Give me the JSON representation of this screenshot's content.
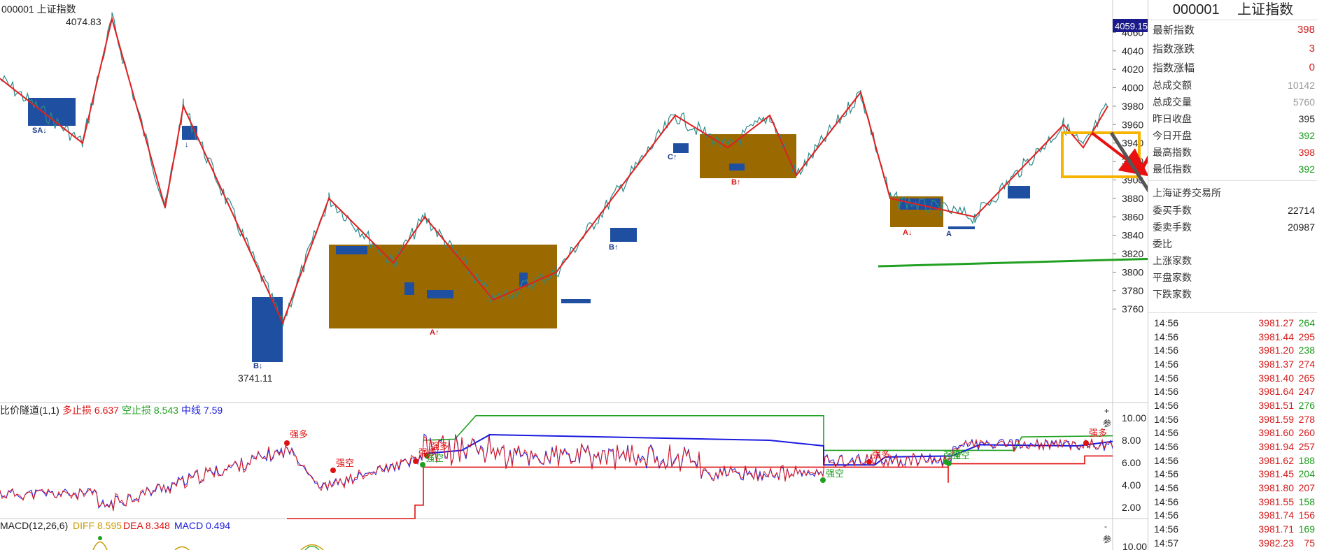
{
  "header": {
    "symbol_title": "000001 上证指数",
    "high_marker": "4074.83",
    "low_marker": "3741.11",
    "current_price_box": "4059.15"
  },
  "price_axis": {
    "ticks": [
      "4060",
      "4040",
      "4020",
      "4000",
      "3980",
      "3960",
      "3940",
      "3920",
      "3900",
      "3880",
      "3860",
      "3840",
      "3820",
      "3800",
      "3780",
      "3760"
    ]
  },
  "signal_labels": [
    {
      "text": "SA↓",
      "color": "#1b3a8a"
    },
    {
      "text": "↓",
      "color": "#1b3a8a"
    },
    {
      "text": "B↓",
      "color": "#1b3a8a"
    },
    {
      "text": "A↑",
      "color": "#d41a1a"
    },
    {
      "text": "B↑",
      "color": "#1b3a8a"
    },
    {
      "text": "C↑",
      "color": "#1b3a8a"
    },
    {
      "text": "B↑",
      "color": "#d41a1a"
    },
    {
      "text": "A↓",
      "color": "#d41a1a"
    },
    {
      "text": "A",
      "color": "#1b3a8a"
    }
  ],
  "indicator_panel": {
    "legend_name": "比价隧道(1,1)",
    "stop_long_label": "多止损 6.637",
    "stop_short_label": "空止损 8.543",
    "midline_label": "中线 7.59",
    "axis_ticks": [
      "10.00",
      "8.00",
      "6.00",
      "4.00",
      "2.00"
    ],
    "annotations": [
      "强多",
      "强空",
      "强多",
      "强多",
      "强空",
      "强空",
      "强空",
      "强多",
      "强空",
      "强多"
    ],
    "side_buttons": [
      "+",
      "参"
    ]
  },
  "macd_panel": {
    "legend_name": "MACD(12,26,6)",
    "diff_label": "DIFF 8.595",
    "dea_label": "DEA 8.348",
    "macd_label": "MACD 0.494",
    "axis_ticks": [
      "10.00"
    ],
    "side_buttons": [
      "-",
      "参"
    ]
  },
  "quote_panel": {
    "code": "000001",
    "name": "上证指数",
    "rows_main": [
      {
        "label": "最新指数",
        "value": "398",
        "style": "red"
      },
      {
        "label": "指数涨跌",
        "value": "3",
        "style": "red"
      },
      {
        "label": "指数涨幅",
        "value": "0",
        "style": "red"
      }
    ],
    "rows_detail": [
      {
        "label": "总成交额",
        "value": "10142",
        "style": "gray"
      },
      {
        "label": "总成交量",
        "value": "5760",
        "style": "gray"
      },
      {
        "label": "昨日收盘",
        "value": "395",
        "style": "black"
      },
      {
        "label": "今日开盘",
        "value": "392",
        "style": "green"
      },
      {
        "label": "最高指数",
        "value": "398",
        "style": "red"
      },
      {
        "label": "最低指数",
        "value": "392",
        "style": "green"
      }
    ],
    "exchange": "上海证券交易所",
    "rows_orders": [
      {
        "label": "委买手数",
        "value": "22714",
        "style": "black"
      },
      {
        "label": "委卖手数",
        "value": "20987",
        "style": "black"
      },
      {
        "label": "委比",
        "value": "",
        "style": "black"
      },
      {
        "label": "上涨家数",
        "value": "",
        "style": "red"
      },
      {
        "label": "平盘家数",
        "value": "",
        "style": "black"
      },
      {
        "label": "下跌家数",
        "value": "",
        "style": "green"
      }
    ],
    "ticks": [
      {
        "time": "14:56",
        "price": "3981.27",
        "vol": "264",
        "vc": "green"
      },
      {
        "time": "14:56",
        "price": "3981.44",
        "vol": "295",
        "vc": "red"
      },
      {
        "time": "14:56",
        "price": "3981.20",
        "vol": "238",
        "vc": "green"
      },
      {
        "time": "14:56",
        "price": "3981.37",
        "vol": "274",
        "vc": "red"
      },
      {
        "time": "14:56",
        "price": "3981.40",
        "vol": "265",
        "vc": "red"
      },
      {
        "time": "14:56",
        "price": "3981.64",
        "vol": "247",
        "vc": "red"
      },
      {
        "time": "14:56",
        "price": "3981.51",
        "vol": "276",
        "vc": "green"
      },
      {
        "time": "14:56",
        "price": "3981.59",
        "vol": "278",
        "vc": "red"
      },
      {
        "time": "14:56",
        "price": "3981.60",
        "vol": "260",
        "vc": "red"
      },
      {
        "time": "14:56",
        "price": "3981.94",
        "vol": "257",
        "vc": "red"
      },
      {
        "time": "14:56",
        "price": "3981.62",
        "vol": "188",
        "vc": "green"
      },
      {
        "time": "14:56",
        "price": "3981.45",
        "vol": "204",
        "vc": "green"
      },
      {
        "time": "14:56",
        "price": "3981.80",
        "vol": "207",
        "vc": "red"
      },
      {
        "time": "14:56",
        "price": "3981.55",
        "vol": "158",
        "vc": "green"
      },
      {
        "time": "14:56",
        "price": "3981.74",
        "vol": "156",
        "vc": "red"
      },
      {
        "time": "14:56",
        "price": "3981.71",
        "vol": "169",
        "vc": "green"
      },
      {
        "time": "14:57",
        "price": "3982.23",
        "vol": "75",
        "vc": "red"
      }
    ]
  },
  "colors": {
    "zigzag": "#e02020",
    "price_line": "#2a8a8a",
    "box_blue": "#1f4fa0",
    "box_gold": "#9a6a00",
    "highlight_box": "#f6b400",
    "arrow_red": "#e81010",
    "arrow_gray": "#555555",
    "arrow_green": "#20a020",
    "tunnel_green": "#20a020",
    "tunnel_blue": "#1a1ae0",
    "tunnel_red": "#e01010"
  },
  "chart_data": {
    "type": "line",
    "title": "000001 上证指数",
    "ylim": [
      3745,
      4080
    ],
    "labeled_points": [
      {
        "label": "4074.83",
        "y": 4074.83
      },
      {
        "label": "3741.11",
        "y": 3741.11
      },
      {
        "label": "4059.15",
        "y": 4059.15
      }
    ],
    "zigzag_pivots": [
      4010,
      3940,
      4074.83,
      3870,
      3980,
      3745,
      3880,
      3810,
      3860,
      3770,
      3800,
      3970,
      3935,
      3970,
      3905,
      3995,
      3880,
      3860,
      3960,
      3935,
      3980
    ],
    "tunnel": {
      "stop_long": 6.637,
      "stop_short": 8.543,
      "midline": 7.59,
      "ylim": [
        1,
        10.5
      ]
    },
    "macd": {
      "diff": 8.595,
      "dea": 8.348,
      "macd": 0.494
    }
  }
}
